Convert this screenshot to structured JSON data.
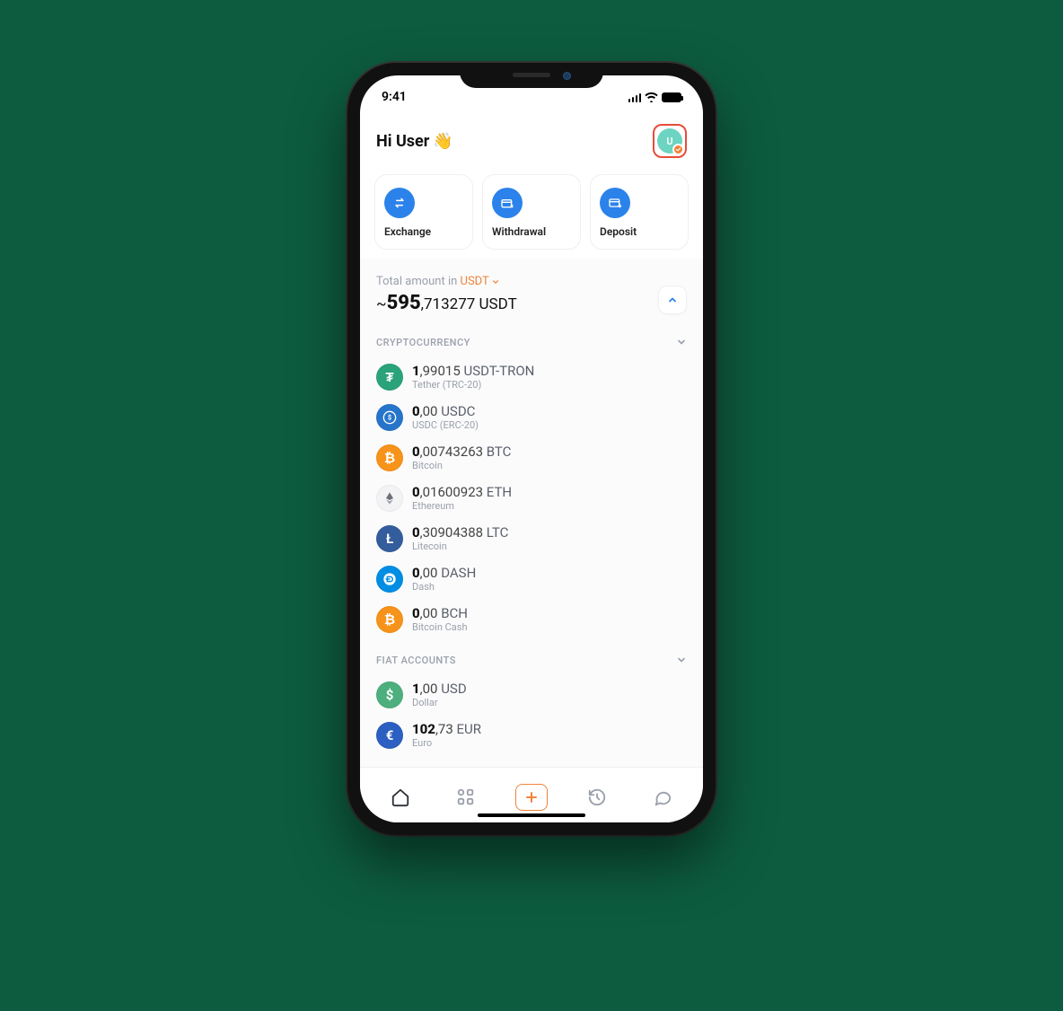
{
  "status": {
    "time": "9:41"
  },
  "header": {
    "greeting": "Hi User",
    "wave": "👋",
    "avatar_initial": "U"
  },
  "actions": {
    "exchange": "Exchange",
    "withdrawal": "Withdrawal",
    "deposit": "Deposit"
  },
  "total": {
    "label_prefix": "Total amount in ",
    "currency": "USDT",
    "approx": "~",
    "int": "595",
    "frac": ",713277",
    "unit": " USDT"
  },
  "sections": {
    "crypto": "Cryptocurrency",
    "fiat": "Fiat Accounts"
  },
  "crypto": [
    {
      "int": "1",
      "frac": ",99015",
      "sym": " USDT-TRON",
      "sub": "Tether (TRC-20)",
      "bg": "#2aa37a",
      "glyph": "₮"
    },
    {
      "int": "0",
      "frac": ",00",
      "sym": " USDC",
      "sub": "USDC (ERC-20)",
      "bg": "#2775ca",
      "glyph": "$"
    },
    {
      "int": "0",
      "frac": ",00743263",
      "sym": " BTC",
      "sub": "Bitcoin",
      "bg": "#f7931a",
      "glyph": "₿"
    },
    {
      "int": "0",
      "frac": ",01600923",
      "sym": " ETH",
      "sub": "Ethereum",
      "bg": "#f3f3f5",
      "glyph": "eth"
    },
    {
      "int": "0",
      "frac": ",30904388",
      "sym": " LTC",
      "sub": "Litecoin",
      "bg": "#345d9d",
      "glyph": "Ł"
    },
    {
      "int": "0",
      "frac": ",00",
      "sym": " DASH",
      "sub": "Dash",
      "bg": "#008de4",
      "glyph": "D"
    },
    {
      "int": "0",
      "frac": ",00",
      "sym": " BCH",
      "sub": "Bitcoin Cash",
      "bg": "#f7931a",
      "glyph": "₿"
    }
  ],
  "fiat": [
    {
      "int": "1",
      "frac": ",00",
      "sym": " USD",
      "sub": "Dollar",
      "bg": "#4caf7d",
      "glyph": "$"
    },
    {
      "int": "102",
      "frac": ",73",
      "sym": " EUR",
      "sub": "Euro",
      "bg": "#2b5fc1",
      "glyph": "€"
    }
  ]
}
